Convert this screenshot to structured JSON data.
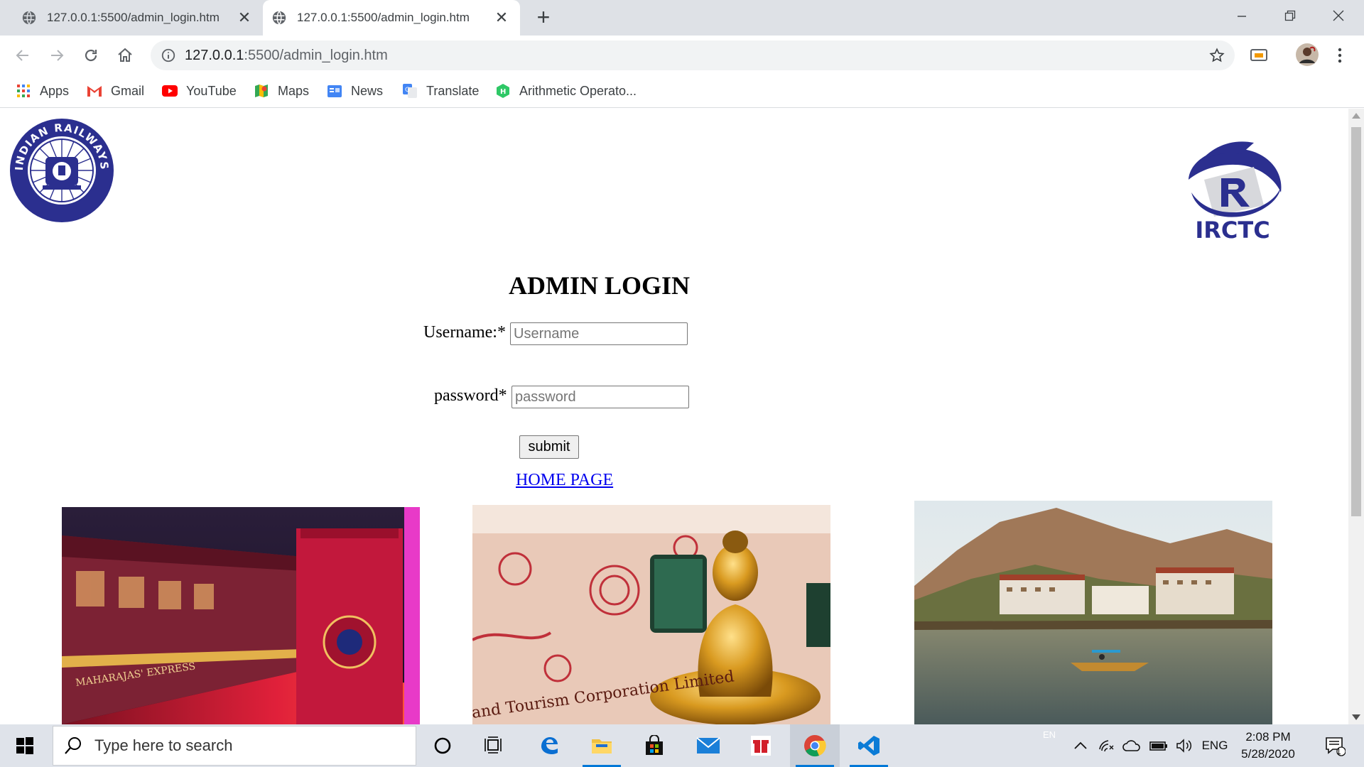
{
  "browser": {
    "tabs": [
      {
        "title": "127.0.0.1:5500/admin_login.htm",
        "active": false
      },
      {
        "title": "127.0.0.1:5500/admin_login.htm",
        "active": true
      }
    ],
    "url_host": "127.0.0.1",
    "url_rest": ":5500/admin_login.htm",
    "bookmarks": [
      {
        "label": "Apps",
        "icon": "apps-grid-icon"
      },
      {
        "label": "Gmail",
        "icon": "gmail-icon"
      },
      {
        "label": "YouTube",
        "icon": "youtube-icon"
      },
      {
        "label": "Maps",
        "icon": "maps-icon"
      },
      {
        "label": "News",
        "icon": "news-icon"
      },
      {
        "label": "Translate",
        "icon": "translate-icon"
      },
      {
        "label": "Arithmetic Operato...",
        "icon": "h-app-icon"
      }
    ]
  },
  "page": {
    "irctc_logo_text": "IRCTC",
    "ir_logo_text": "INDIAN RAILWAYS",
    "heading": "ADMIN LOGIN",
    "username_label": "Username:*",
    "username_placeholder": "Username",
    "password_label": "password*",
    "password_placeholder": "password",
    "submit_label": "submit",
    "home_link": "HOME PAGE",
    "photos": [
      {
        "subject": "maharajas-express-train",
        "caption": "MAHARAJAS' EXPRESS"
      },
      {
        "subject": "buddha-statue-train",
        "caption": "and Tourism Corporation Limited"
      },
      {
        "subject": "lake-houseboats"
      }
    ]
  },
  "taskbar": {
    "search_placeholder": "Type here to search",
    "language": "ENG",
    "lang_small": "EN",
    "time": "2:08 PM",
    "date": "5/28/2020",
    "notification_count": "1"
  },
  "colors": {
    "tab_strip": "#dee1e6",
    "link": "#0000ee",
    "logo_blue": "#2b2f8f",
    "taskbar": "#dfe3ea"
  }
}
